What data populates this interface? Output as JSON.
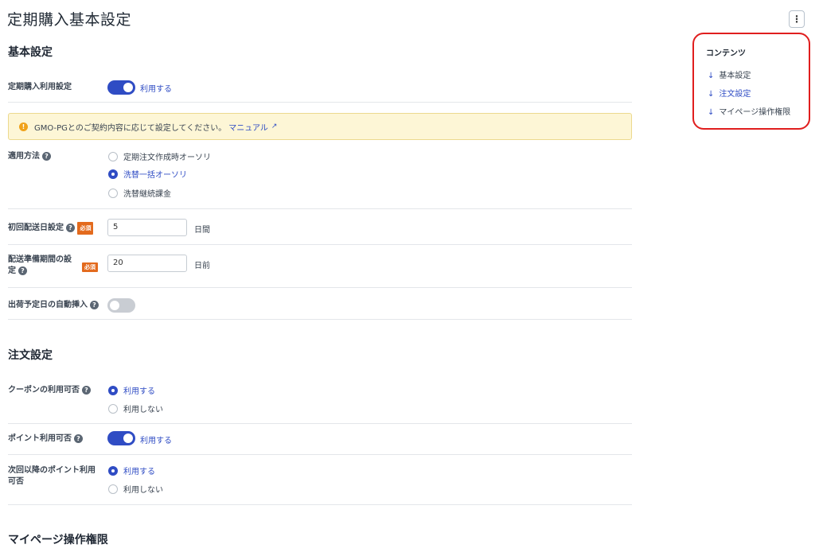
{
  "page_title": "定期購入基本設定",
  "menu_icon": "⋮",
  "sections": {
    "basic": "基本設定",
    "order": "注文設定",
    "mypage": "マイページ操作権限"
  },
  "subscription_use": {
    "label": "定期購入利用設定",
    "toggle_text": "利用する",
    "on": true
  },
  "notice": {
    "text": "GMO-PGとのご契約内容に応じて設定してください。",
    "link": "マニュアル",
    "icon": "!",
    "ext_icon": "↗"
  },
  "apply_method": {
    "label": "適用方法",
    "options": [
      "定期注文作成時オーソリ",
      "洗替一括オーソリ",
      "洗替継続課金"
    ],
    "selected": 1
  },
  "first_delivery": {
    "label": "初回配送日設定",
    "required": "必須",
    "value": "5",
    "unit": "日間"
  },
  "prep_period": {
    "label_line1": "配送準備期間の設",
    "label_line2": "定",
    "required": "必須",
    "value": "20",
    "unit": "日前"
  },
  "auto_ship_date": {
    "label": "出荷予定日の自動挿入",
    "on": false
  },
  "coupon": {
    "label": "クーポンの利用可否",
    "options": [
      "利用する",
      "利用しない"
    ],
    "selected": 0
  },
  "point_use": {
    "label": "ポイント利用可否",
    "toggle_text": "利用する",
    "on": true
  },
  "next_point": {
    "label_line1": "次回以降のポイント利用",
    "label_line2": "可否",
    "options": [
      "利用する",
      "利用しない"
    ],
    "selected": 0
  },
  "help_icon": "?",
  "toc": {
    "title": "コンテンツ",
    "arrow": "↓",
    "items": [
      "基本設定",
      "注文設定",
      "マイページ操作権限"
    ],
    "active": 1
  },
  "colors": {
    "accent": "#2f4cc4",
    "required": "#e36a1d",
    "highlight_border": "#e01e1e",
    "notice_bg": "#fdf6d6"
  }
}
